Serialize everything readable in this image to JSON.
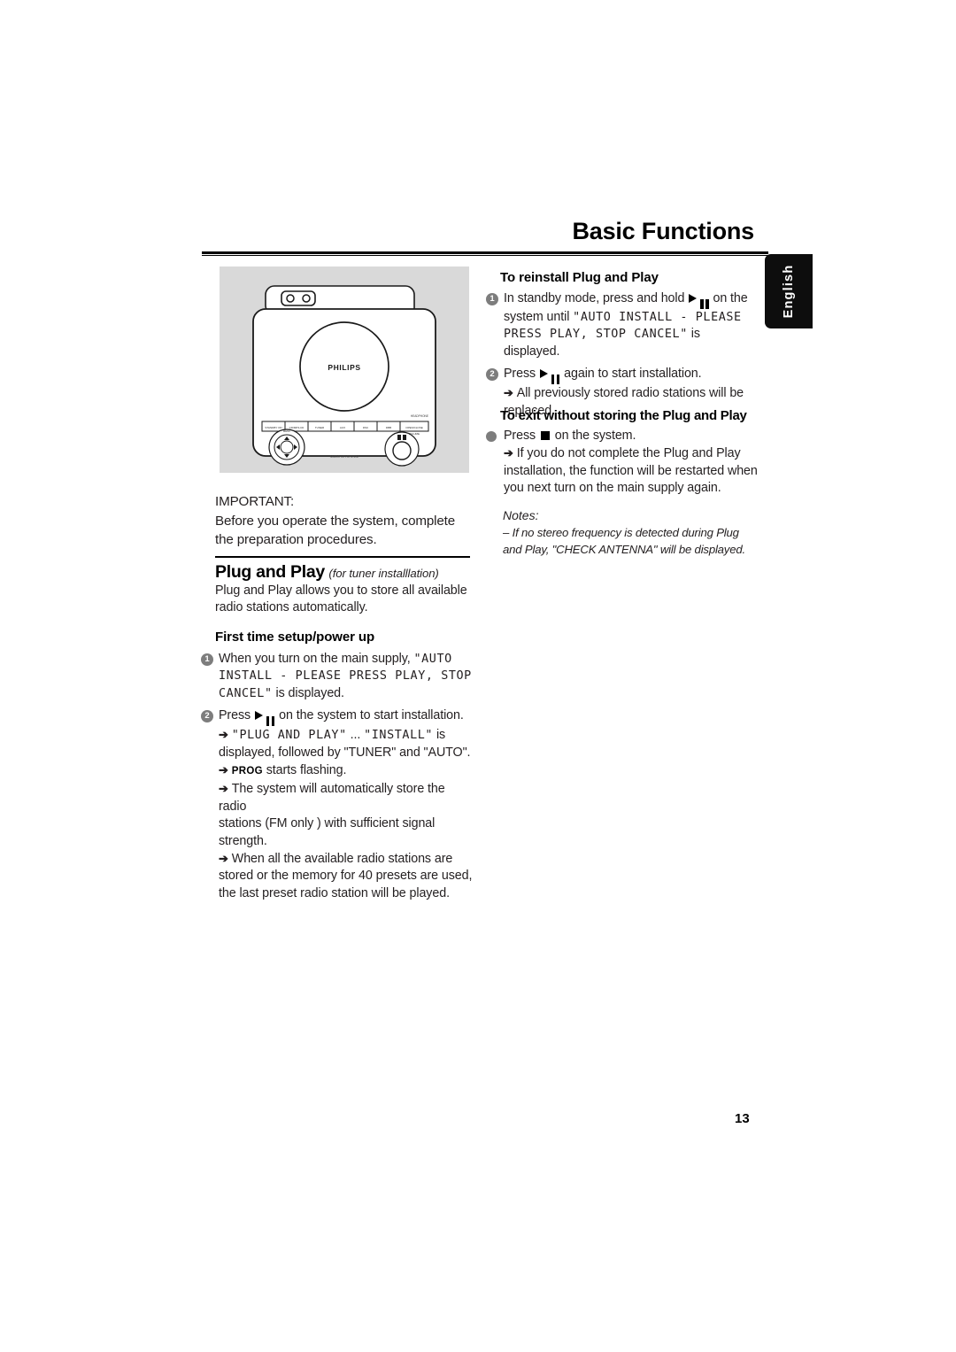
{
  "header": {
    "title": "Basic Functions"
  },
  "language_tab": {
    "label": "English"
  },
  "illustration": {
    "brand_logo": "PHILIPS",
    "caption_right": "HEADPHONE",
    "caption_bottom": "MICRO HIFI SYSTEM",
    "left_knob_label": "MENU",
    "right_knob_label": "VOLUME",
    "button_labels": [
      "STANDBY ON",
      "CD/MP3-CD",
      "TUNER",
      "AUX",
      "DSC",
      "DBB",
      "OPEN/CLOSE"
    ]
  },
  "left_column": {
    "important_label": "IMPORTANT:",
    "important_lines": [
      "Before you operate the system, complete",
      "the preparation procedures."
    ],
    "pnp_heading": "Plug and Play",
    "pnp_heading_sub": "(for tuner installlation)",
    "pnp_intro": [
      "Plug and Play allows you to store all available",
      "radio stations automatically."
    ],
    "first_time_heading": "First time setup/power up",
    "step1": {
      "number": "1",
      "text_before": "When you turn on the main supply,",
      "lcd_1": "\"AUTO",
      "lcd_2": "INSTALL - PLEASE PRESS PLAY, STOP",
      "lcd_3": "CANCEL\"",
      "text_after": "is displayed."
    },
    "step2": {
      "number": "2",
      "text_before": "Press",
      "text_after": "on the system to start installation.",
      "sub_items": [
        {
          "arrow": "➔",
          "lcd_a": "\"PLUG AND PLAY\"",
          "mid": "...",
          "lcd_b": "\"INSTALL\"",
          "tail": "is",
          "line2": "displayed, followed by \"TUNER\" and \"AUTO\"."
        },
        {
          "arrow": "➔",
          "tag": "PROG",
          "tail": "starts flashing."
        },
        {
          "arrow": "➔",
          "lines": [
            "The system will automatically store the radio",
            "stations (FM only ) with sufficient signal strength."
          ]
        },
        {
          "arrow": "➔",
          "lines": [
            "When all the available radio stations are",
            "stored or the memory for 40 presets are used,",
            "the last preset radio station will be played."
          ]
        }
      ]
    }
  },
  "right_column": {
    "heading_reinstall": "To reinstall Plug and Play",
    "step1": {
      "number": "1",
      "text_before": "In standby mode, press and hold",
      "text_after": "on the",
      "line2_before": "system until",
      "lcd_1": "\"AUTO  INSTALL - PLEASE",
      "lcd_2": "PRESS PLAY, STOP CANCEL\"",
      "line3_after": "is displayed."
    },
    "step2": {
      "number": "2",
      "text_before": "Press",
      "text_after": "again to start installation.",
      "sub_arrow": "➔",
      "sub_lines": [
        "All previously stored radio stations will be",
        "replaced."
      ]
    },
    "heading_exit": "To exit without storing the Plug and Play",
    "exit_step": {
      "text_before": "Press",
      "text_after": "on the system.",
      "sub_arrow": "➔",
      "sub_lines": [
        "If you do not complete the Plug and Play",
        "installation, the function will be restarted when",
        "you next turn on the main supply again."
      ]
    },
    "notes_heading": "Notes:",
    "notes_dash": "–",
    "notes_lines": [
      "If no stereo frequency is detected during Plug",
      "and Play, \"CHECK ANTENNA\" will be displayed."
    ]
  },
  "footer": {
    "page_number": "13"
  },
  "colors": {
    "page_background": "#ffffff",
    "text": "#231f20",
    "illustration_background": "#d9d9d9",
    "bullet_gray": "#7d7d7d",
    "tab_background": "#0d0d0d"
  }
}
